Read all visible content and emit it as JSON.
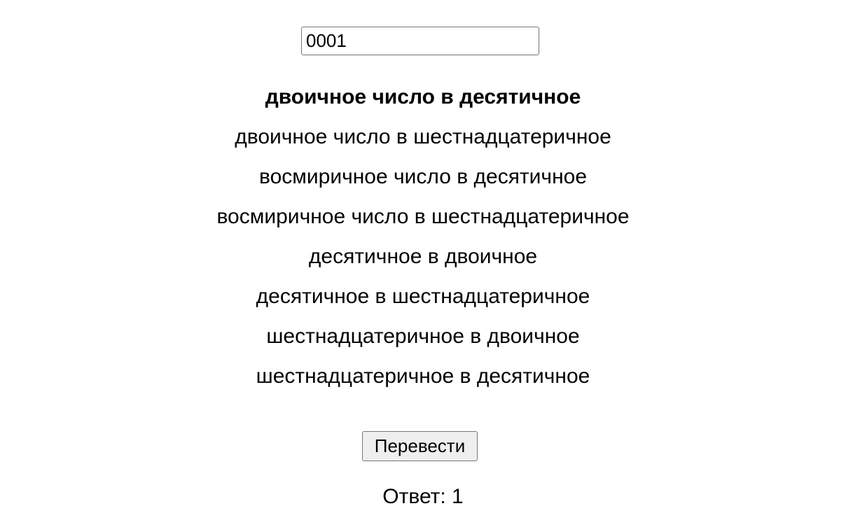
{
  "input": {
    "value": "0001"
  },
  "options": [
    {
      "label": "двоичное число в десятичное",
      "selected": true
    },
    {
      "label": "двоичное число в шестнадцатеричное",
      "selected": false
    },
    {
      "label": "восмиричное число в десятичное",
      "selected": false
    },
    {
      "label": "восмиричное число в шестнадцатеричное",
      "selected": false
    },
    {
      "label": "десятичное в двоичное",
      "selected": false
    },
    {
      "label": "десятичное в шестнадцатеричное",
      "selected": false
    },
    {
      "label": "шестнадцатеричное в двоичное",
      "selected": false
    },
    {
      "label": "шестнадцатеричное в десятичное",
      "selected": false
    }
  ],
  "button": {
    "label": "Перевести"
  },
  "answer": {
    "text": "Ответ: 1"
  }
}
